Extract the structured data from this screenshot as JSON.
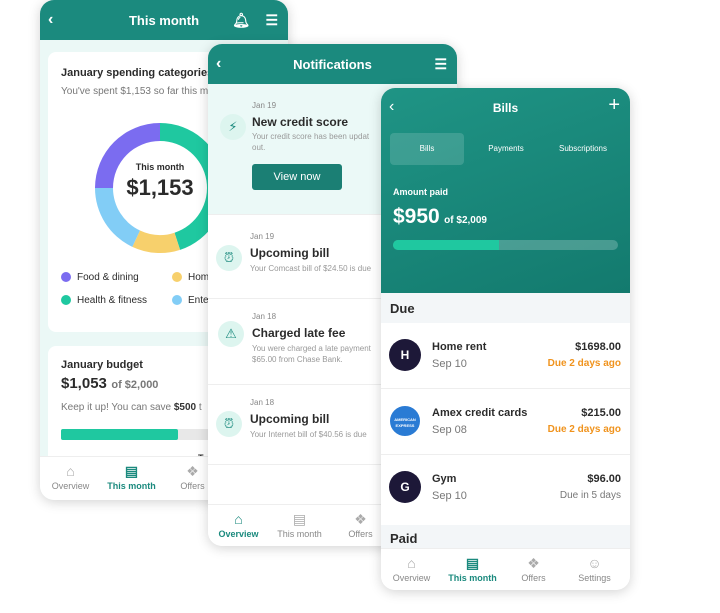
{
  "this_month": {
    "title": "This month",
    "spending": {
      "title": "January spending categories",
      "subtitle": "You've spent $1,153 so far this m",
      "center_label": "This month",
      "center_value": "$1,153",
      "segments": [
        {
          "label": "Food & dining",
          "color": "#7b6cf0",
          "share": 0.25
        },
        {
          "label": "Hom",
          "color": "#f7d06c",
          "share": 0.12
        },
        {
          "label": "Health & fitness",
          "color": "#1fc8a0",
          "share": 0.45
        },
        {
          "label": "Ente",
          "color": "#82cdf6",
          "share": 0.18
        }
      ]
    },
    "budget": {
      "title": "January budget",
      "amount": "$1,053",
      "of": "of $2,000",
      "tip_prefix": "Keep it up! You can save ",
      "tip_bold": "$500",
      "tip_suffix": " t",
      "progress": 0.53,
      "partial": "To"
    },
    "nav": [
      "Overview",
      "This month",
      "Offers"
    ]
  },
  "notifications": {
    "title": "Notifications",
    "items": [
      {
        "date": "Jan 19",
        "title": "New credit score",
        "body": "Your credit score has been updat",
        "body2": "out.",
        "icon": "lightning-icon",
        "button": "View now"
      },
      {
        "date": "Jan 19",
        "title": "Upcoming bill",
        "body": "Your Comcast bill of $24.50 is due",
        "icon": "alarm-clock-icon"
      },
      {
        "date": "Jan 18",
        "title": "Charged late fee",
        "body": "You were charged a late payment",
        "body2": "$65.00 from Chase Bank.",
        "icon": "warning-icon"
      },
      {
        "date": "Jan 18",
        "title": "Upcoming bill",
        "body": "Your Internet bill of $40.56 is due",
        "icon": "alarm-clock-icon"
      }
    ],
    "nav": [
      "Overview",
      "This month",
      "Offers"
    ]
  },
  "bills": {
    "title": "Bills",
    "tabs": [
      "Bills",
      "Payments",
      "Subscriptions"
    ],
    "amount_label": "Amount paid",
    "amount": "$950",
    "of": "of $2,009",
    "progress": 0.47,
    "due_header": "Due",
    "paid_header": "Paid",
    "items": [
      {
        "initial": "H",
        "name": "Home rent",
        "date": "Sep 10",
        "amount": "$1698.00",
        "status": "Due 2 days ago",
        "late": true
      },
      {
        "initial": "AMERICAN EXPRESS",
        "name": "Amex credit cards",
        "date": "Sep 08",
        "amount": "$215.00",
        "status": "Due 2 days ago",
        "late": true
      },
      {
        "initial": "G",
        "name": "Gym",
        "date": "Sep 10",
        "amount": "$96.00",
        "status": "Due in 5 days",
        "late": false
      }
    ],
    "nav": [
      "Overview",
      "This month",
      "Offers",
      "Settings"
    ]
  },
  "colors": {
    "brand": "#1b8a7e",
    "accent": "#1fc8a0",
    "late": "#f0931d"
  }
}
